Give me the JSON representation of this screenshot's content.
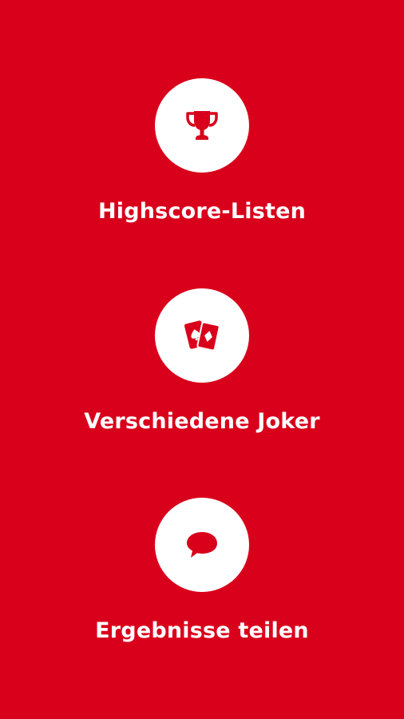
{
  "colors": {
    "background": "#d9001b",
    "circle": "#ffffff",
    "icon": "#d9001b",
    "label": "#ffffff"
  },
  "features": [
    {
      "label": "Highscore-Listen",
      "icon": "trophy-icon"
    },
    {
      "label": "Verschiedene Joker",
      "icon": "playing-cards-icon"
    },
    {
      "label": "Ergebnisse teilen",
      "icon": "speech-bubble-icon"
    }
  ]
}
